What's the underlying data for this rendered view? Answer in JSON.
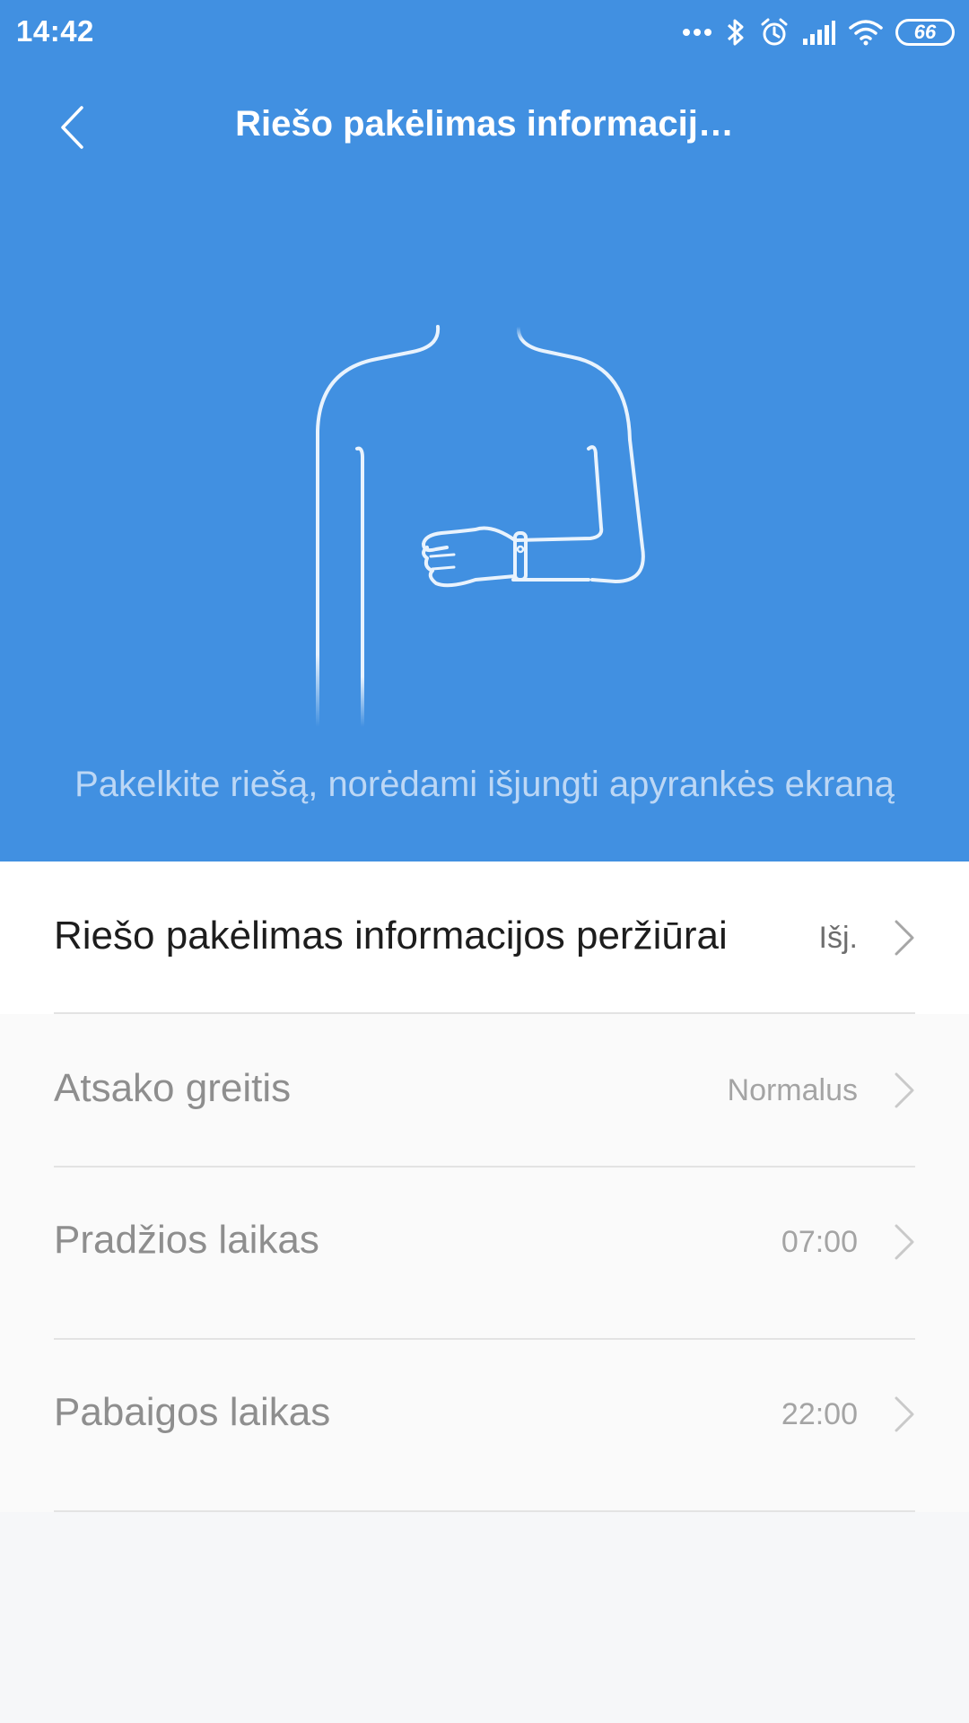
{
  "status_bar": {
    "time": "14:42",
    "battery_level": "66",
    "icons": [
      "more-dots-icon",
      "bluetooth-icon",
      "alarm-icon",
      "cellular-signal-icon",
      "wifi-icon",
      "battery-icon"
    ]
  },
  "header": {
    "title": "Riešo pakėlimas informacij…",
    "back_icon": "chevron-left-icon"
  },
  "hero": {
    "illustration": "person-raising-wrist-band-illustration",
    "caption": "Pakelkite riešą, norėdami išjungti apyrankės ekraną"
  },
  "settings": [
    {
      "label": "Riešo pakėlimas informacijos peržiūrai",
      "value": "Išj.",
      "enabled": true
    },
    {
      "label": "Atsako greitis",
      "value": "Normalus",
      "enabled": false
    },
    {
      "label": "Pradžios laikas",
      "value": "07:00",
      "enabled": false
    },
    {
      "label": "Pabaigos laikas",
      "value": "22:00",
      "enabled": false
    }
  ],
  "colors": {
    "hero_background": "#4190e1",
    "page_background": "#f6f7f9",
    "caption_text": "#bcd7f5"
  }
}
